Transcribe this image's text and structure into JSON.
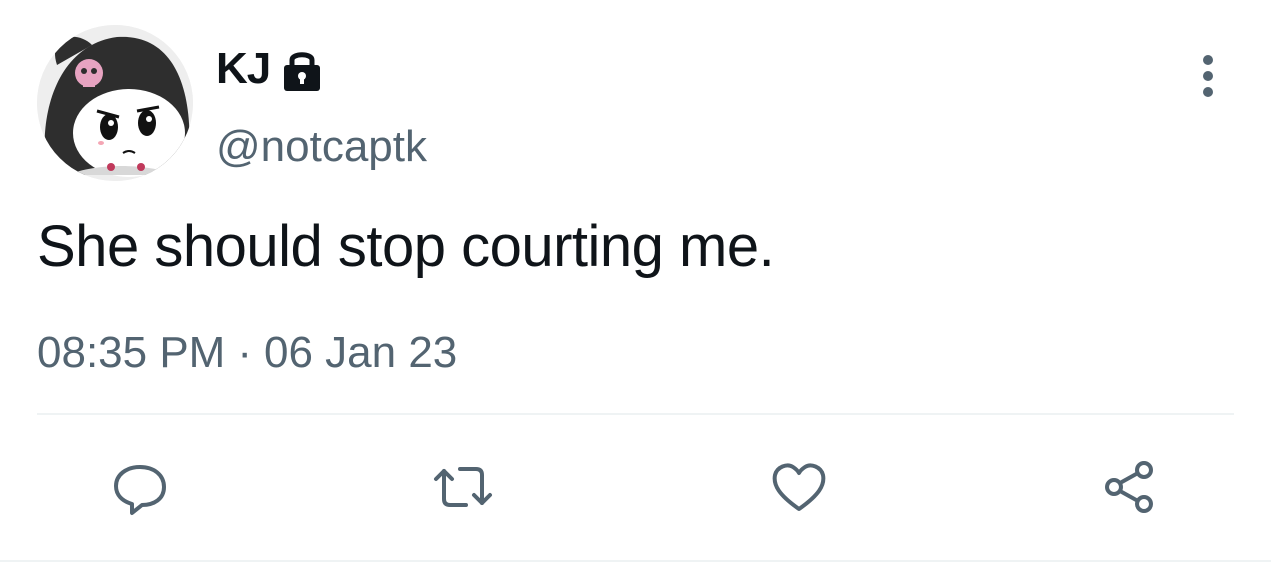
{
  "author": {
    "display_name": "KJ",
    "handle": "@notcaptk",
    "protected": true
  },
  "tweet": {
    "text": "She should stop courting me.",
    "time": "08:35 PM",
    "separator": "·",
    "date": "06 Jan 23"
  },
  "icons": {
    "lock": "lock-icon",
    "more": "more-vertical-icon",
    "reply": "reply-icon",
    "retweet": "retweet-icon",
    "like": "heart-icon",
    "share": "share-icon"
  },
  "colors": {
    "text_primary": "#0f1419",
    "text_secondary": "#536471",
    "divider": "#eff3f4"
  }
}
